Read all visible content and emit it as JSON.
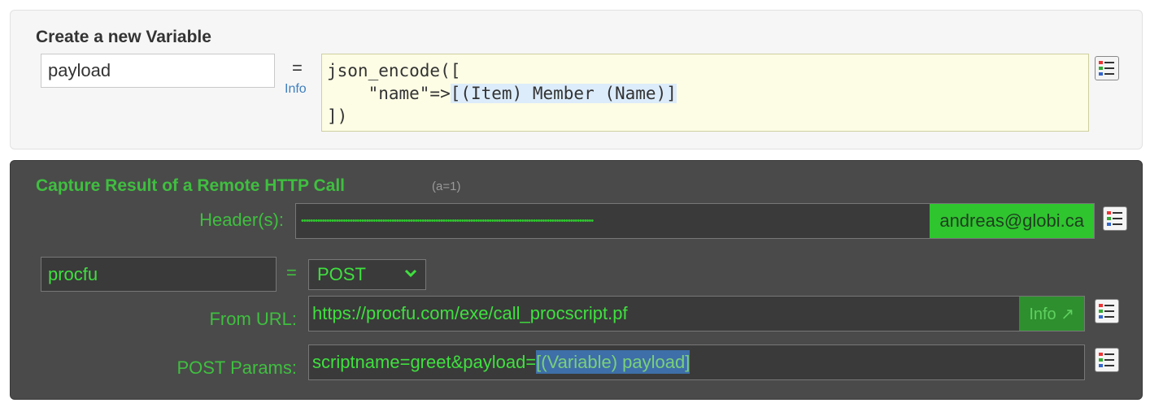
{
  "create_var": {
    "title": "Create a new Variable",
    "name_value": "payload",
    "equals": "=",
    "info_label": "Info",
    "code_line1": "json_encode([",
    "code_line2_prefix": "    \"name\"=>",
    "code_line2_token": "[(Item) Member (Name)]",
    "code_line3": "])"
  },
  "http_call": {
    "title": "Capture Result of a Remote HTTP Call",
    "subtitle": "(a=1)",
    "headers_label": "Header(s):",
    "headers_masked": "••••••••••••••••••••••••••••••••••••••••••••••••••••••••••••••••••••••••••••••••••••••••••••••••••••••••••••••••••••••••••••••",
    "headers_email": "andreas@globi.ca",
    "result_var": "procfu",
    "equals": "=",
    "method": "POST",
    "url_label": "From URL:",
    "url_value": "https://procfu.com/exe/call_procscript.pf",
    "url_info": "Info ↗",
    "params_label": "POST Params:",
    "params_prefix": "scriptname=greet&payload=",
    "params_token": "[(Variable) payload]"
  },
  "colors": {
    "accent_green": "#3fbf3f",
    "dark_panel": "#4a4a4a",
    "code_bg": "#fdfde5",
    "token_blue": "#3e6fa8"
  },
  "icons": [
    "list-picker-icon",
    "chevron-down-icon"
  ]
}
